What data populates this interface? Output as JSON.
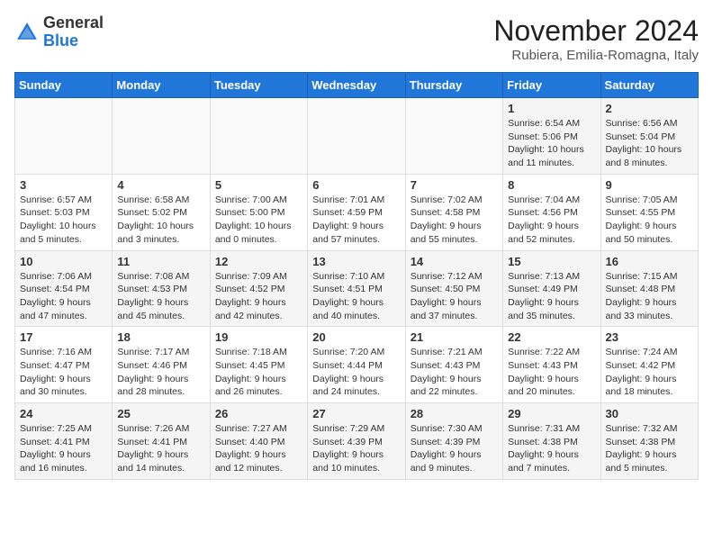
{
  "header": {
    "logo_general": "General",
    "logo_blue": "Blue",
    "month_year": "November 2024",
    "location": "Rubiera, Emilia-Romagna, Italy"
  },
  "days_of_week": [
    "Sunday",
    "Monday",
    "Tuesday",
    "Wednesday",
    "Thursday",
    "Friday",
    "Saturday"
  ],
  "weeks": [
    [
      {
        "day": "",
        "info": ""
      },
      {
        "day": "",
        "info": ""
      },
      {
        "day": "",
        "info": ""
      },
      {
        "day": "",
        "info": ""
      },
      {
        "day": "",
        "info": ""
      },
      {
        "day": "1",
        "info": "Sunrise: 6:54 AM\nSunset: 5:06 PM\nDaylight: 10 hours and 11 minutes."
      },
      {
        "day": "2",
        "info": "Sunrise: 6:56 AM\nSunset: 5:04 PM\nDaylight: 10 hours and 8 minutes."
      }
    ],
    [
      {
        "day": "3",
        "info": "Sunrise: 6:57 AM\nSunset: 5:03 PM\nDaylight: 10 hours and 5 minutes."
      },
      {
        "day": "4",
        "info": "Sunrise: 6:58 AM\nSunset: 5:02 PM\nDaylight: 10 hours and 3 minutes."
      },
      {
        "day": "5",
        "info": "Sunrise: 7:00 AM\nSunset: 5:00 PM\nDaylight: 10 hours and 0 minutes."
      },
      {
        "day": "6",
        "info": "Sunrise: 7:01 AM\nSunset: 4:59 PM\nDaylight: 9 hours and 57 minutes."
      },
      {
        "day": "7",
        "info": "Sunrise: 7:02 AM\nSunset: 4:58 PM\nDaylight: 9 hours and 55 minutes."
      },
      {
        "day": "8",
        "info": "Sunrise: 7:04 AM\nSunset: 4:56 PM\nDaylight: 9 hours and 52 minutes."
      },
      {
        "day": "9",
        "info": "Sunrise: 7:05 AM\nSunset: 4:55 PM\nDaylight: 9 hours and 50 minutes."
      }
    ],
    [
      {
        "day": "10",
        "info": "Sunrise: 7:06 AM\nSunset: 4:54 PM\nDaylight: 9 hours and 47 minutes."
      },
      {
        "day": "11",
        "info": "Sunrise: 7:08 AM\nSunset: 4:53 PM\nDaylight: 9 hours and 45 minutes."
      },
      {
        "day": "12",
        "info": "Sunrise: 7:09 AM\nSunset: 4:52 PM\nDaylight: 9 hours and 42 minutes."
      },
      {
        "day": "13",
        "info": "Sunrise: 7:10 AM\nSunset: 4:51 PM\nDaylight: 9 hours and 40 minutes."
      },
      {
        "day": "14",
        "info": "Sunrise: 7:12 AM\nSunset: 4:50 PM\nDaylight: 9 hours and 37 minutes."
      },
      {
        "day": "15",
        "info": "Sunrise: 7:13 AM\nSunset: 4:49 PM\nDaylight: 9 hours and 35 minutes."
      },
      {
        "day": "16",
        "info": "Sunrise: 7:15 AM\nSunset: 4:48 PM\nDaylight: 9 hours and 33 minutes."
      }
    ],
    [
      {
        "day": "17",
        "info": "Sunrise: 7:16 AM\nSunset: 4:47 PM\nDaylight: 9 hours and 30 minutes."
      },
      {
        "day": "18",
        "info": "Sunrise: 7:17 AM\nSunset: 4:46 PM\nDaylight: 9 hours and 28 minutes."
      },
      {
        "day": "19",
        "info": "Sunrise: 7:18 AM\nSunset: 4:45 PM\nDaylight: 9 hours and 26 minutes."
      },
      {
        "day": "20",
        "info": "Sunrise: 7:20 AM\nSunset: 4:44 PM\nDaylight: 9 hours and 24 minutes."
      },
      {
        "day": "21",
        "info": "Sunrise: 7:21 AM\nSunset: 4:43 PM\nDaylight: 9 hours and 22 minutes."
      },
      {
        "day": "22",
        "info": "Sunrise: 7:22 AM\nSunset: 4:43 PM\nDaylight: 9 hours and 20 minutes."
      },
      {
        "day": "23",
        "info": "Sunrise: 7:24 AM\nSunset: 4:42 PM\nDaylight: 9 hours and 18 minutes."
      }
    ],
    [
      {
        "day": "24",
        "info": "Sunrise: 7:25 AM\nSunset: 4:41 PM\nDaylight: 9 hours and 16 minutes."
      },
      {
        "day": "25",
        "info": "Sunrise: 7:26 AM\nSunset: 4:41 PM\nDaylight: 9 hours and 14 minutes."
      },
      {
        "day": "26",
        "info": "Sunrise: 7:27 AM\nSunset: 4:40 PM\nDaylight: 9 hours and 12 minutes."
      },
      {
        "day": "27",
        "info": "Sunrise: 7:29 AM\nSunset: 4:39 PM\nDaylight: 9 hours and 10 minutes."
      },
      {
        "day": "28",
        "info": "Sunrise: 7:30 AM\nSunset: 4:39 PM\nDaylight: 9 hours and 9 minutes."
      },
      {
        "day": "29",
        "info": "Sunrise: 7:31 AM\nSunset: 4:38 PM\nDaylight: 9 hours and 7 minutes."
      },
      {
        "day": "30",
        "info": "Sunrise: 7:32 AM\nSunset: 4:38 PM\nDaylight: 9 hours and 5 minutes."
      }
    ]
  ]
}
